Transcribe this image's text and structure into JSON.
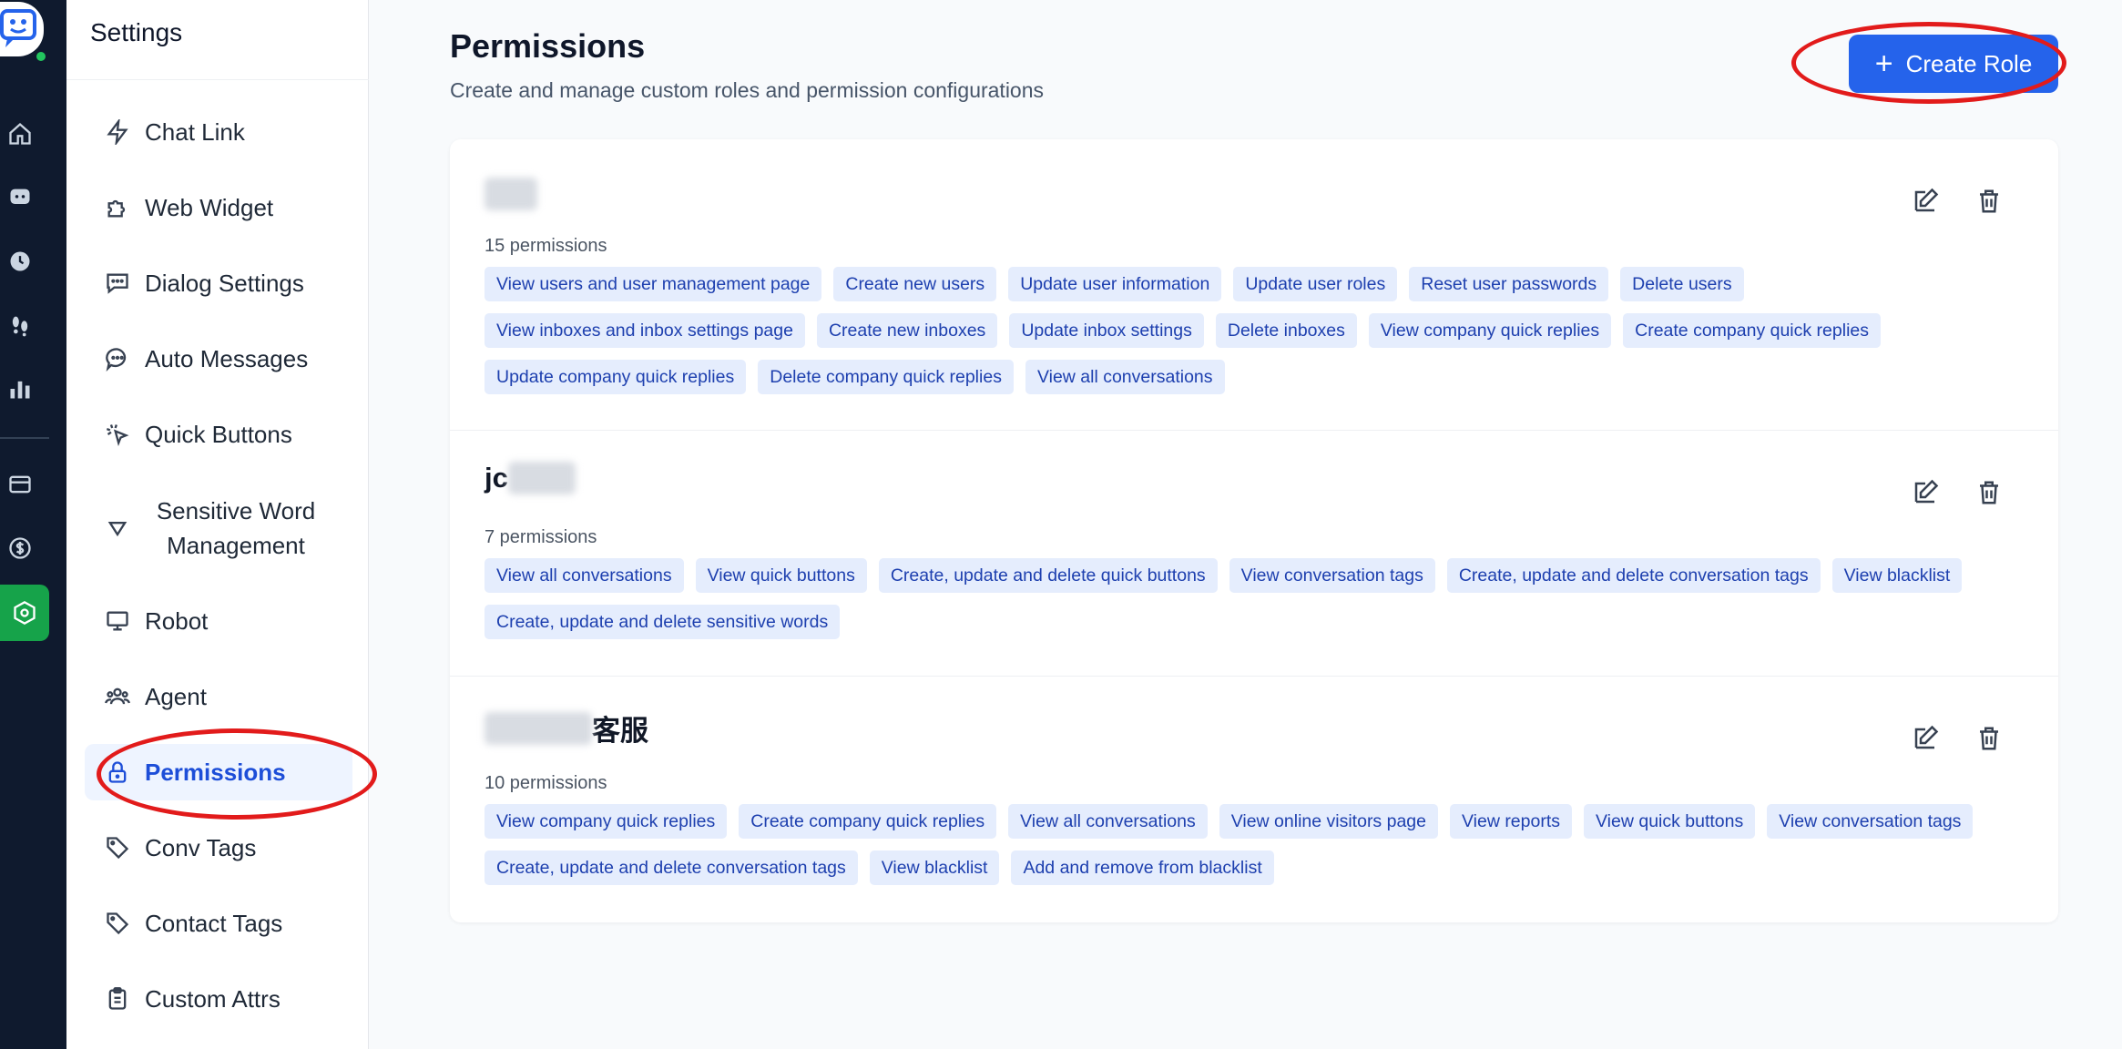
{
  "sidebar": {
    "title": "Settings",
    "items": [
      {
        "label": "Chat Link",
        "icon": "bolt-icon"
      },
      {
        "label": "Web Widget",
        "icon": "puzzle-icon"
      },
      {
        "label": "Dialog Settings",
        "icon": "chat-square-icon"
      },
      {
        "label": "Auto Messages",
        "icon": "chat-bubble-icon"
      },
      {
        "label": "Quick Buttons",
        "icon": "cursor-click-icon"
      },
      {
        "label": "Sensitive Word Management",
        "icon": "funnel-icon"
      },
      {
        "label": "Robot",
        "icon": "monitor-icon"
      },
      {
        "label": "Agent",
        "icon": "users-icon"
      },
      {
        "label": "Permissions",
        "icon": "lock-icon",
        "active": true
      },
      {
        "label": "Conv Tags",
        "icon": "tag-icon"
      },
      {
        "label": "Contact Tags",
        "icon": "tag-icon"
      },
      {
        "label": "Custom Attrs",
        "icon": "clipboard-icon"
      }
    ]
  },
  "rail": {
    "icons": [
      "home-icon",
      "chat-icon",
      "history-icon",
      "footprints-icon",
      "bar-chart-icon",
      "billing-card-icon",
      "dollar-icon",
      "settings-hex-icon"
    ],
    "active": "settings-hex-icon"
  },
  "header": {
    "title": "Permissions",
    "subtitle": "Create and manage custom roles and permission configurations",
    "create_label": "Create Role"
  },
  "roles": [
    {
      "name_visible": "",
      "count": "15 permissions",
      "permissions": [
        "View users and user management page",
        "Create new users",
        "Update user information",
        "Update user roles",
        "Reset user passwords",
        "Delete users",
        "View inboxes and inbox settings page",
        "Create new inboxes",
        "Update inbox settings",
        "Delete inboxes",
        "View company quick replies",
        "Create company quick replies",
        "Update company quick replies",
        "Delete company quick replies",
        "View all conversations"
      ]
    },
    {
      "name_visible": "jc",
      "count": "7 permissions",
      "permissions": [
        "View all conversations",
        "View quick buttons",
        "Create, update and delete quick buttons",
        "View conversation tags",
        "Create, update and delete conversation tags",
        "View blacklist",
        "Create, update and delete sensitive words"
      ]
    },
    {
      "name_visible": "客服",
      "count": "10 permissions",
      "permissions": [
        "View company quick replies",
        "Create company quick replies",
        "View all conversations",
        "View online visitors page",
        "View reports",
        "View quick buttons",
        "View conversation tags",
        "Create, update and delete conversation tags",
        "View blacklist",
        "Add and remove from blacklist"
      ]
    }
  ],
  "colors": {
    "accent": "#2563eb",
    "rail_bg": "#0f1a2e",
    "rail_active": "#16a34a",
    "tag_bg": "#e5edfd",
    "tag_text": "#1e40af",
    "annotation": "#e21b1b"
  }
}
